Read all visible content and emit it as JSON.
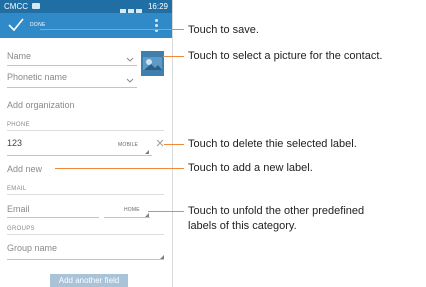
{
  "status_bar": {
    "carrier": "CMCC",
    "time": "16:29"
  },
  "action_bar": {
    "done_label": "DONE",
    "check_icon": "check-icon",
    "menu_icon": "overflow-menu-icon"
  },
  "form": {
    "name_placeholder": "Name",
    "phonetic_placeholder": "Phonetic name",
    "organization_link": "Add organization",
    "phone_header": "PHONE",
    "phone_value": "123",
    "phone_type": "MOBILE",
    "add_new_label": "Add new",
    "email_header": "EMAIL",
    "email_placeholder": "Email",
    "email_type": "HOME",
    "groups_header": "GROUPS",
    "group_placeholder": "Group name",
    "add_field_button": "Add another field"
  },
  "annotations": {
    "save": "Touch to save.",
    "picture": "Touch to select a picture for the contact.",
    "delete": "Touch to delete thie selected label.",
    "add_label": "Touch to add a new label.",
    "unfold_line1": "Touch to unfold the other predefined",
    "unfold_line2": "labels of this category."
  },
  "colors": {
    "status_bar": "#1f6fa5",
    "action_bar": "#2f8ac7",
    "callout": "#f08a3a",
    "button": "#a9c3d8"
  }
}
